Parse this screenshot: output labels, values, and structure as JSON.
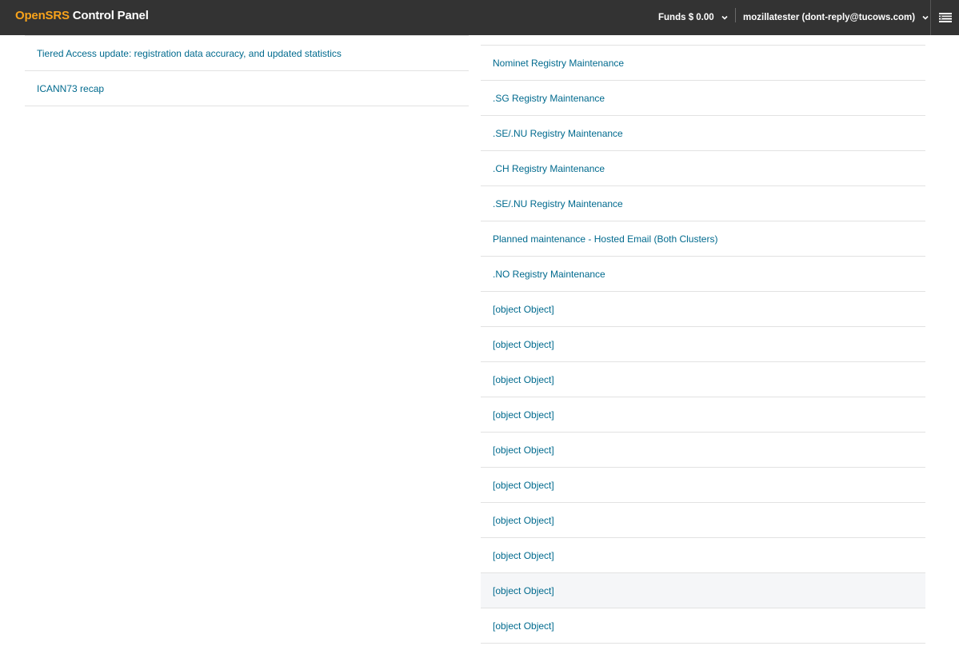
{
  "header": {
    "brand_part1": "OpenSRS",
    "brand_part2": " Control Panel",
    "funds_label": "Funds $ 0.00",
    "user_label": "mozillatester (dont-reply@tucows.com)",
    "accent_color": "#f7a21b",
    "bar_color": "#333333"
  },
  "left_list": {
    "items": [
      "Tiered Access update: registration data accuracy, and updated statistics",
      "ICANN73 recap"
    ]
  },
  "right_list": {
    "items": [
      "Nominet Registry Maintenance",
      ".SG Registry Maintenance",
      ".SE/.NU Registry Maintenance",
      ".CH Registry Maintenance",
      ".SE/.NU Registry Maintenance",
      "Planned maintenance - Hosted Email (Both Clusters)",
      ".NO Registry Maintenance",
      "[object Object]",
      "[object Object]",
      "[object Object]",
      "[object Object]",
      "[object Object]",
      "[object Object]",
      "[object Object]",
      "[object Object]",
      "[object Object]",
      "[object Object]"
    ],
    "highlighted_index": 15
  },
  "link_color": "#006a8e"
}
